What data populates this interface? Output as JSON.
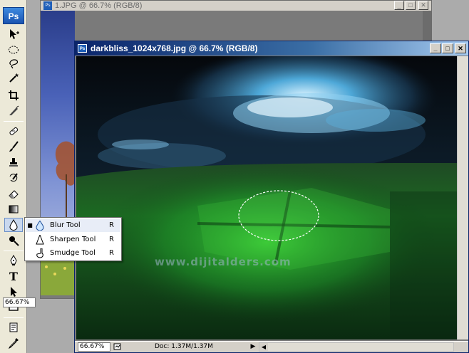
{
  "app": {
    "logo": "Ps"
  },
  "back_document": {
    "title": "1.JPG @ 66.7% (RGB/8)",
    "zoom": "66.67%"
  },
  "front_document": {
    "title": "darkbliss_1024x768.jpg @ 66.7% (RGB/8)",
    "watermark": "www.dijitalders.com",
    "zoom": "66.67%",
    "doc_info": "Doc: 1.37M/1.37M"
  },
  "window_buttons": {
    "minimize": "_",
    "maximize": "□",
    "close": "✕"
  },
  "flyout": {
    "items": [
      {
        "label": "Blur Tool",
        "shortcut": "R",
        "icon": "blur-drop-icon",
        "selected": true,
        "bullet": "■"
      },
      {
        "label": "Sharpen Tool",
        "shortcut": "R",
        "icon": "sharpen-cone-icon",
        "selected": false,
        "bullet": ""
      },
      {
        "label": "Smudge Tool",
        "shortcut": "R",
        "icon": "smudge-finger-icon",
        "selected": false,
        "bullet": ""
      }
    ]
  },
  "toolbox": {
    "tools": [
      "move-tool-icon",
      "marquee-tool-icon",
      "lasso-tool-icon",
      "magic-wand-icon",
      "crop-tool-icon",
      "slice-tool-icon",
      "healing-brush-icon",
      "brush-tool-icon",
      "clone-stamp-icon",
      "history-brush-icon",
      "eraser-tool-icon",
      "gradient-tool-icon",
      "blur-tool-icon",
      "dodge-tool-icon",
      "pen-tool-icon",
      "type-tool-icon",
      "path-selection-icon",
      "rectangle-tool-icon",
      "notes-tool-icon"
    ],
    "type_glyph": "T"
  },
  "colors": {
    "titlebar_active": "#0a246a",
    "chrome": "#d4d0c8",
    "workspace": "#ababab"
  }
}
